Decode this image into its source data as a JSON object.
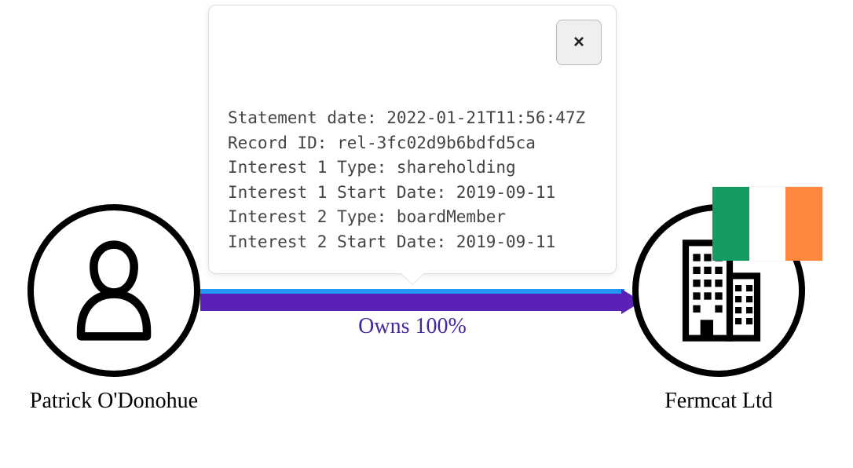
{
  "nodes": {
    "person": {
      "label": "Patrick O'Donohue",
      "icon": "person-icon"
    },
    "company": {
      "label": "Fermcat Ltd",
      "icon": "building-icon",
      "flag": "ireland"
    }
  },
  "edge": {
    "label": "Owns 100%",
    "colors": {
      "top": "#2196f3",
      "body": "#5B21B6",
      "text": "#4527A0"
    }
  },
  "popover": {
    "close_label": "×",
    "lines": [
      "Statement date: 2022-01-21T11:56:47Z",
      "Record ID: rel-3fc02d9b6bdfd5ca",
      "Interest 1 Type: shareholding",
      "Interest 1 Start Date: 2019-09-11",
      "Interest 2 Type: boardMember",
      "Interest 2 Start Date: 2019-09-11"
    ]
  }
}
